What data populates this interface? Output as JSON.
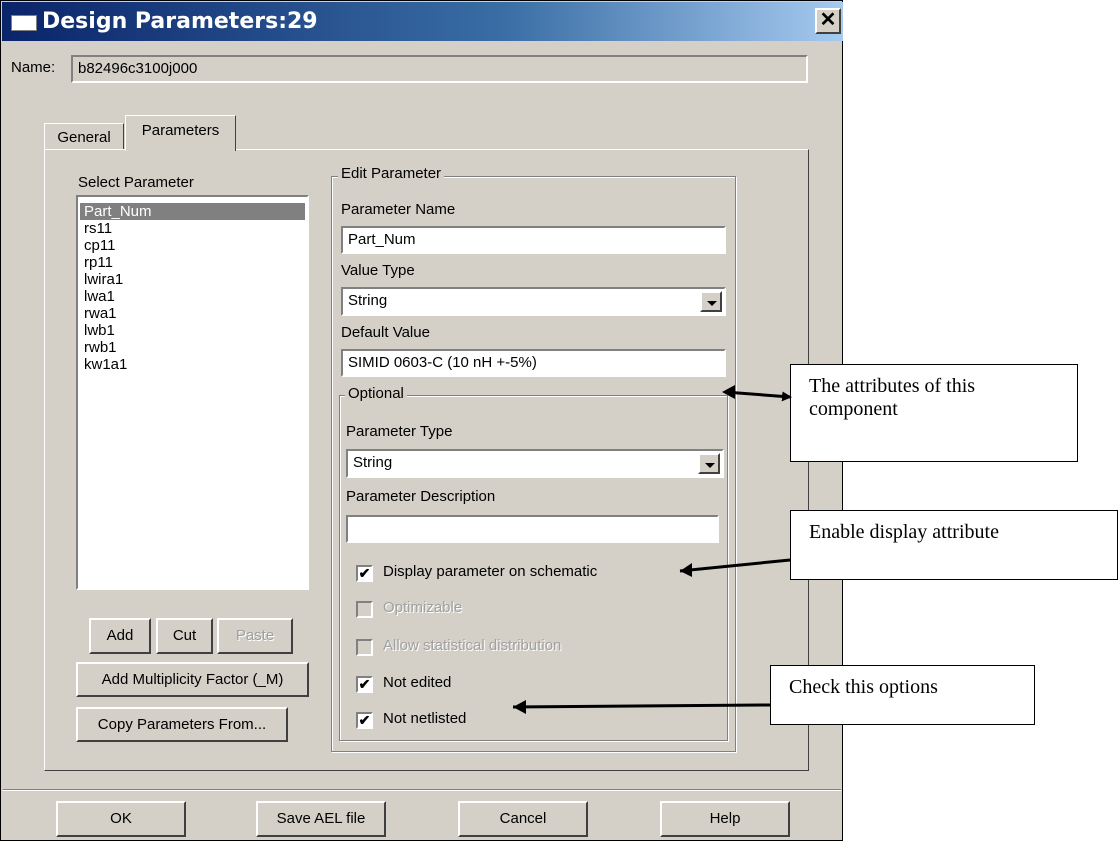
{
  "window": {
    "title": "Design Parameters:29",
    "close_label": "✕"
  },
  "name_field": {
    "label": "Name:",
    "value": "b82496c3100j000"
  },
  "tabs": [
    {
      "label": "General",
      "active": false
    },
    {
      "label": "Parameters",
      "active": true
    }
  ],
  "select_parameter": {
    "label": "Select Parameter",
    "items": [
      "Part_Num",
      "rs11",
      "cp11",
      "rp11",
      "lwira1",
      "lwa1",
      "rwa1",
      "lwb1",
      "rwb1",
      "kw1a1"
    ],
    "selected_index": 0
  },
  "list_buttons": {
    "add": "Add",
    "cut": "Cut",
    "paste": "Paste"
  },
  "add_multiplicity_label": "Add Multiplicity Factor (_M)",
  "copy_params_label": "Copy Parameters From...",
  "edit_parameter": {
    "group_label": "Edit Parameter",
    "param_name_label": "Parameter Name",
    "param_name_value": "Part_Num",
    "value_type_label": "Value Type",
    "value_type_value": "String",
    "default_value_label": "Default Value",
    "default_value_value": "SIMID 0603-C (10 nH +-5%)"
  },
  "optional": {
    "group_label": "Optional",
    "param_type_label": "Parameter Type",
    "param_type_value": "String",
    "param_desc_label": "Parameter Description",
    "param_desc_value": "",
    "checkboxes": [
      {
        "label": "Display parameter on schematic",
        "checked": true,
        "enabled": true
      },
      {
        "label": "Optimizable",
        "checked": false,
        "enabled": false
      },
      {
        "label": "Allow statistical distribution",
        "checked": false,
        "enabled": false
      },
      {
        "label": "Not edited",
        "checked": true,
        "enabled": true
      },
      {
        "label": "Not netlisted",
        "checked": true,
        "enabled": true
      }
    ]
  },
  "bottom_buttons": {
    "ok": "OK",
    "save_ael": "Save AEL file",
    "cancel": "Cancel",
    "help": "Help"
  },
  "callouts": {
    "attributes": "The attributes of this component",
    "display": "Enable display attribute",
    "check": "Check this options"
  },
  "check_glyph": "✔"
}
